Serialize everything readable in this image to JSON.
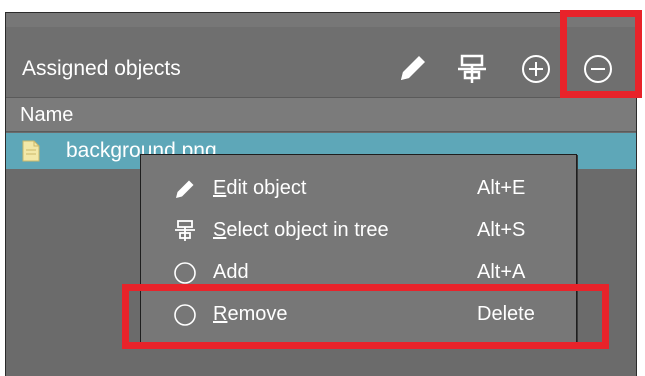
{
  "panel": {
    "title": "Assigned objects",
    "toolbar": {
      "icons": [
        "pencil-icon",
        "select-in-tree-icon",
        "plus-circle-icon",
        "minus-circle-icon"
      ]
    },
    "column_header": "Name",
    "rows": [
      {
        "label": "background.png",
        "icon": "file-icon",
        "selected": true
      }
    ]
  },
  "context_menu": {
    "items": [
      {
        "prefix": "",
        "mnemonic": "E",
        "rest": "dit object",
        "shortcut": "Alt+E",
        "icon": "pencil-icon"
      },
      {
        "prefix": "",
        "mnemonic": "S",
        "rest": "elect object in tree",
        "shortcut": "Alt+S",
        "icon": "select-in-tree-icon"
      },
      {
        "prefix": "Add",
        "mnemonic": "",
        "rest": "",
        "shortcut": "Alt+A",
        "icon": "circle-icon"
      },
      {
        "prefix": "",
        "mnemonic": "R",
        "rest": "emove",
        "shortcut": "Delete",
        "icon": "circle-icon"
      }
    ]
  },
  "colors": {
    "highlight": "#e8232a",
    "selection": "#5ea7b8",
    "panel_bg": "#6b6b6b",
    "menu_bg": "#777777"
  }
}
